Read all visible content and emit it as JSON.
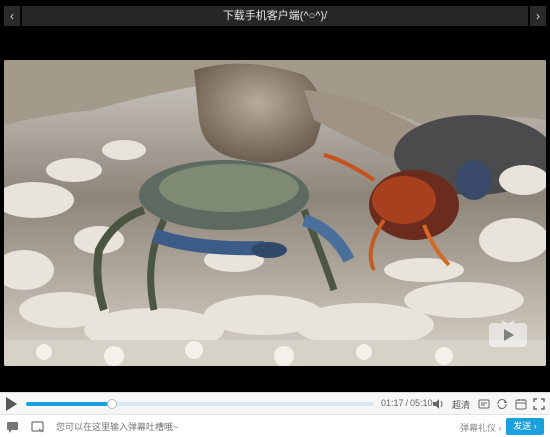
{
  "banner": {
    "title": "下载手机客户端(^○^)/",
    "prev_icon": "chevron-left-icon",
    "next_icon": "chevron-right-icon"
  },
  "player": {
    "current_time": "01:17",
    "time_separator": "/",
    "total_time": "05:10",
    "progress_fraction": 0.248,
    "quality_label": "超清",
    "watermark_icon": "video-logo-icon",
    "icons": [
      "play-icon",
      "volume-icon",
      "danmaku-toggle-icon",
      "loop-icon",
      "danmaku-settings-icon",
      "fullscreen-icon"
    ]
  },
  "danmaku": {
    "placeholder": "您可以在这里输入弹幕吐槽哦~",
    "etiquette_label": "弹幕礼仪 ›",
    "send_label": "发送 ›",
    "icons": [
      "danmaku-chat-icon",
      "danmaku-screen-icon"
    ]
  },
  "colors": {
    "accent": "#1aa0dc",
    "topbar_bg": "#262626",
    "controls_bg": "#f6f6f6"
  }
}
